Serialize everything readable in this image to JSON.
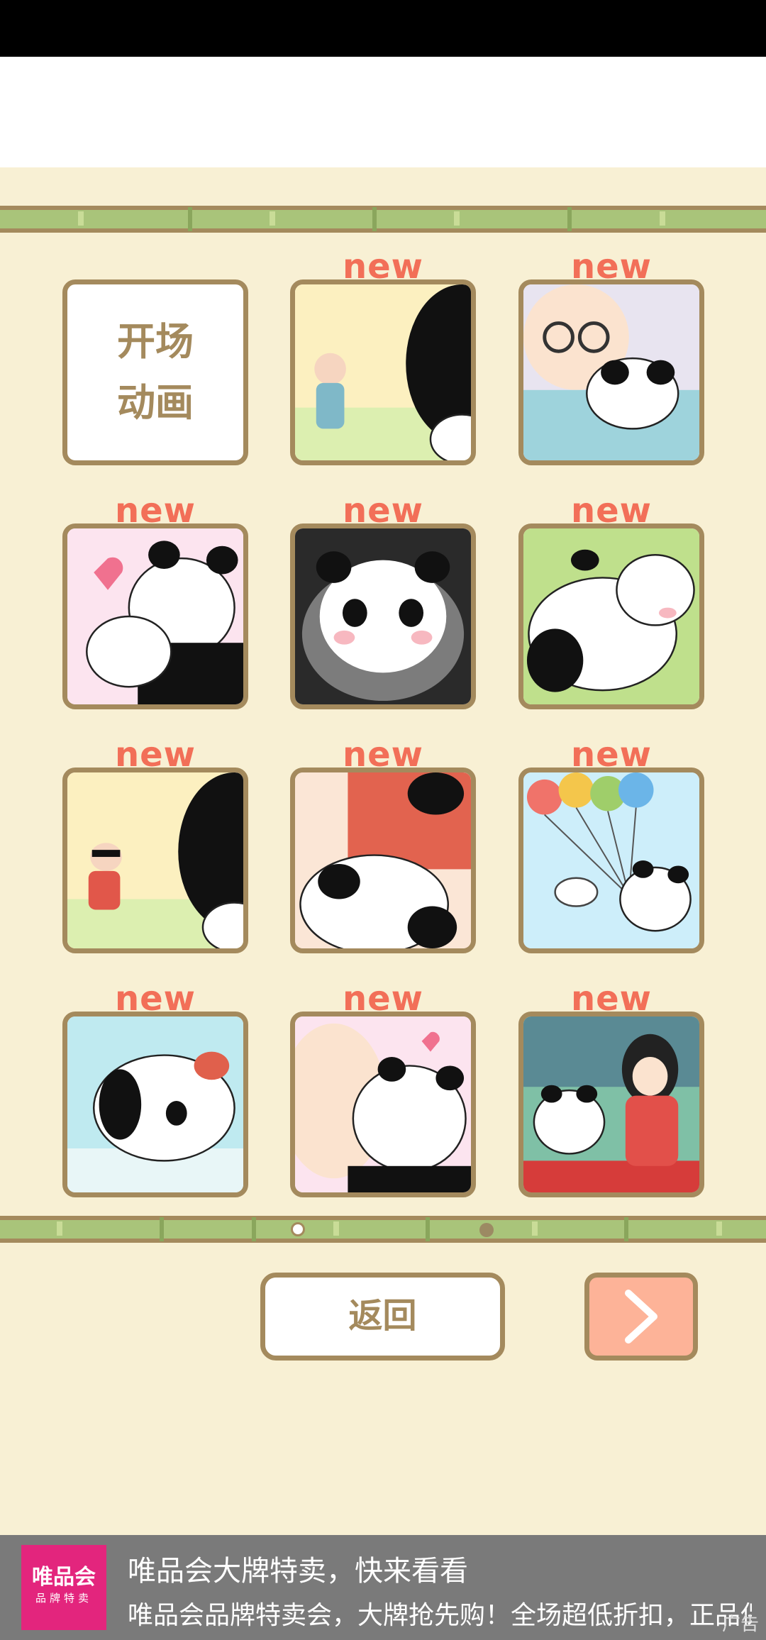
{
  "gallery": {
    "new_label": "new",
    "opening_cell": {
      "line1": "开场",
      "line2": "动画"
    },
    "thumbnails": [
      {
        "icon": "old-man-waving-panda-icon"
      },
      {
        "icon": "glasses-man-hugging-panda-icon"
      },
      {
        "icon": "panda-mother-baby-heart-icon"
      },
      {
        "icon": "happy-panda-pot-icon"
      },
      {
        "icon": "panda-lying-grass-icon"
      },
      {
        "icon": "sunglasses-man-running-panda-icon"
      },
      {
        "icon": "red-man-with-panda-icon"
      },
      {
        "icon": "panda-balloons-bird-icon"
      },
      {
        "icon": "panda-with-leaf-icon"
      },
      {
        "icon": "bald-man-kissing-panda-icon"
      },
      {
        "icon": "kimono-girl-panda-bamboo-icon"
      }
    ]
  },
  "pagination": {
    "pages": 2,
    "current": 1
  },
  "controls": {
    "back_label": "返回",
    "next_icon": "chevron-right-icon"
  },
  "ad": {
    "logo_line1": "唯品会",
    "logo_line2": "品牌特卖",
    "title": "唯品会大牌特卖，快来看看",
    "desc": "唯品会品牌特卖会，大牌抢先购！全场超低折扣，正品保",
    "tag": "广告"
  },
  "colors": {
    "background": "#f8f0d4",
    "frame": "#a48a5d",
    "new_label": "#f26f58",
    "next_button": "#fdb398",
    "ad_logo": "#e3257d"
  }
}
